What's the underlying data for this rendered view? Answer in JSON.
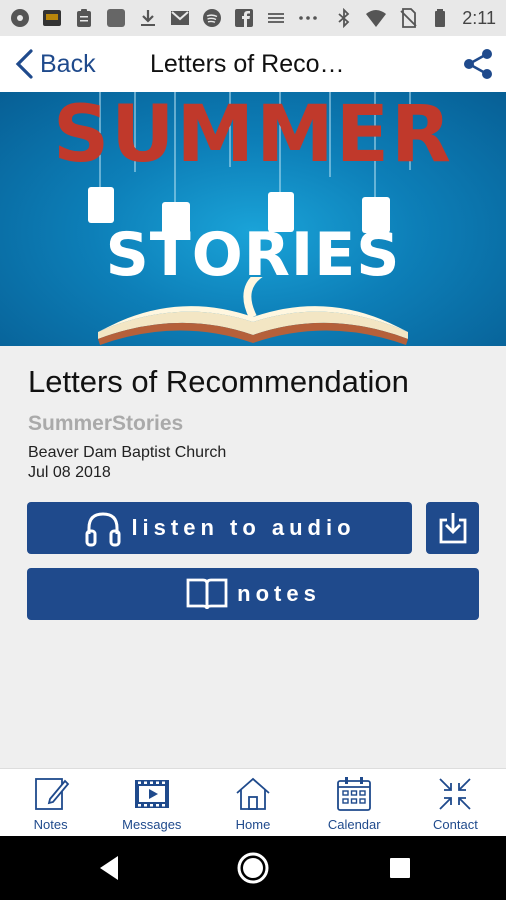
{
  "status_bar": {
    "time": "2:11",
    "icons": [
      "dashboard-icon",
      "sports-app-icon",
      "clipboard-icon",
      "square-app-icon",
      "download-icon",
      "gmail-icon",
      "spotify-icon",
      "facebook-icon",
      "news-icon",
      "more-icon",
      "bluetooth-icon",
      "wifi-icon",
      "no-sim-icon",
      "battery-icon"
    ]
  },
  "header": {
    "back_label": "Back",
    "title": "Letters of Reco…"
  },
  "banner": {
    "line1": "SUMMER",
    "line2": "STORIES"
  },
  "sermon": {
    "title": "Letters of Recommendation",
    "series": "SummerStories",
    "church": "Beaver Dam Baptist Church",
    "date": "Jul 08 2018"
  },
  "actions": {
    "listen_label": "listen to audio",
    "notes_label": "notes"
  },
  "tabs": [
    {
      "label": "Notes",
      "icon": "notes-icon"
    },
    {
      "label": "Messages",
      "icon": "film-icon"
    },
    {
      "label": "Home",
      "icon": "home-icon"
    },
    {
      "label": "Calendar",
      "icon": "calendar-icon"
    },
    {
      "label": "Contact",
      "icon": "arrows-in-icon"
    }
  ],
  "colors": {
    "accent": "#1f4a8c",
    "banner_red": "#c0392b",
    "banner_blue": "#0d7fb8"
  }
}
